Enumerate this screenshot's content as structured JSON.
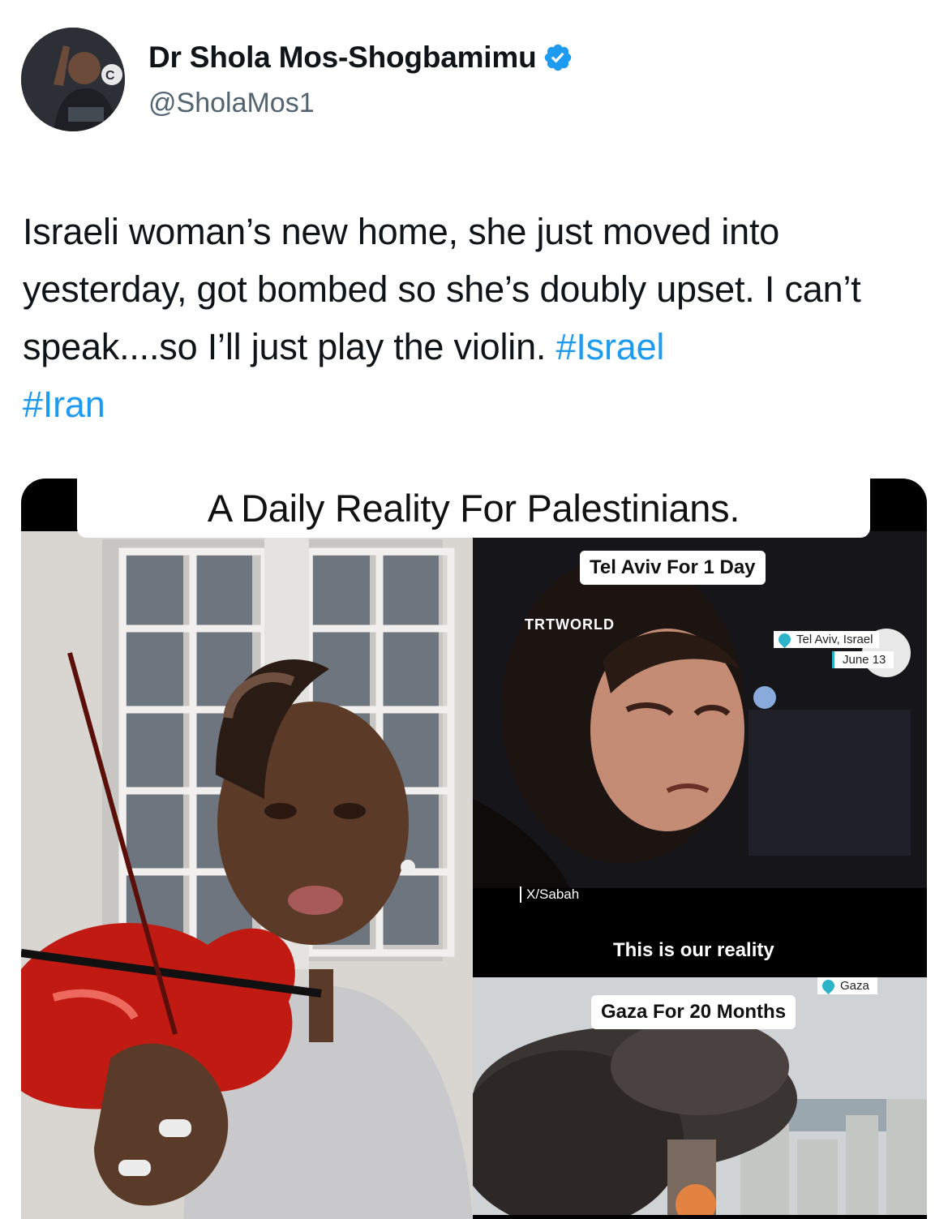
{
  "tweet": {
    "author_name": "Dr Shola Mos-Shogbamimu",
    "handle": "@SholaMos1",
    "text_plain": "Israeli woman’s new home, she just moved into yesterday, got bombed so she’s  doubly upset. I can’t speak....so I’ll just play the violin.",
    "hashtags": [
      "#Israel",
      "#Iran"
    ]
  },
  "icons": {
    "verified": "verified-badge-icon",
    "location": "location-pin-icon"
  },
  "colors": {
    "hashtag": "#1d9bf0",
    "verified": "#1d9bf0",
    "handle": "#536471"
  },
  "media": {
    "banner": "A Daily Reality For Palestinians.",
    "tel_aviv_label": "Tel Aviv For 1 Day",
    "trt_logo": "TRTWORLD",
    "location_1": "Tel Aviv, Israel",
    "date_1": "June 13",
    "credit": "X/Sabah",
    "caption": "This is our reality",
    "location_2": "Gaza",
    "gaza_label": "Gaza For 20 Months"
  }
}
